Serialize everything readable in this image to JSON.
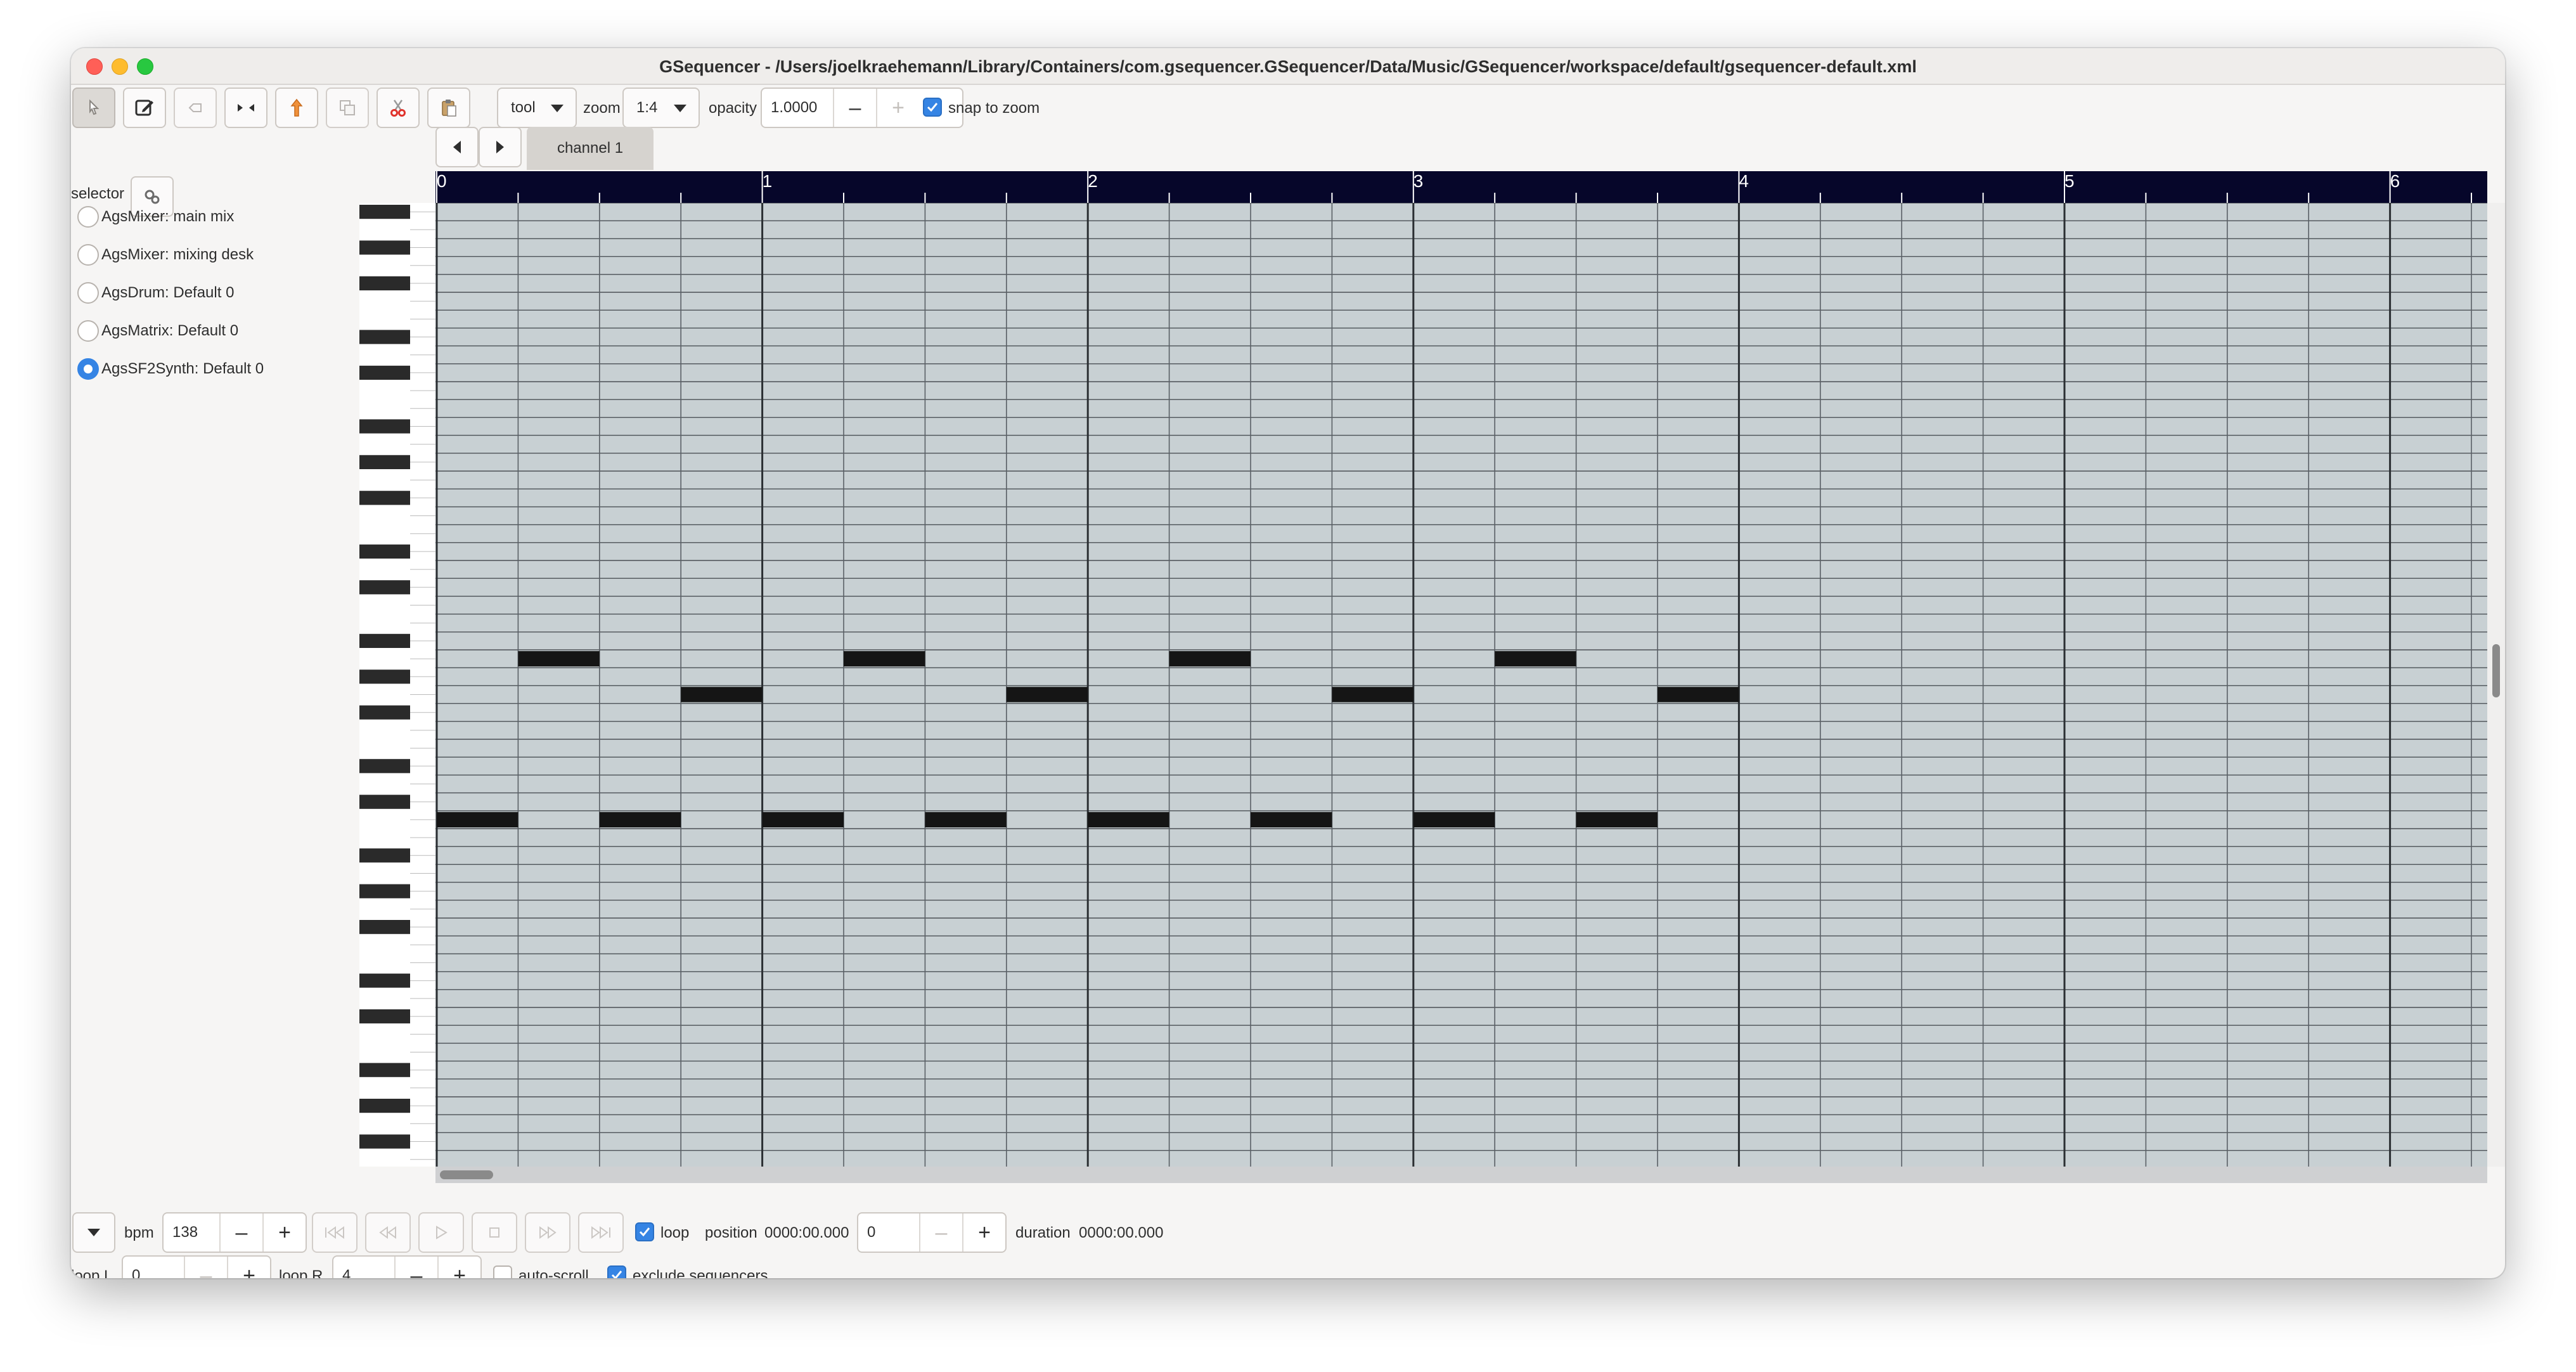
{
  "window": {
    "title": "GSequencer - /Users/joelkraehemann/Library/Containers/com.gsequencer.GSequencer/Data/Music/GSequencer/workspace/default/gsequencer-default.xml"
  },
  "toolbar": {
    "tool_label": "tool",
    "zoom_label": "zoom",
    "zoom_value": "1:4",
    "opacity_label": "opacity",
    "opacity_value": "1.0000",
    "snap_label": "snap to zoom",
    "snap_checked": true,
    "buttons": [
      "pointer",
      "edit",
      "clear",
      "select",
      "position",
      "copy",
      "cut",
      "paste"
    ]
  },
  "selector": {
    "label": "selector",
    "machines": [
      {
        "label": "AgsMixer: main mix",
        "selected": false
      },
      {
        "label": "AgsMixer: mixing desk",
        "selected": false
      },
      {
        "label": "AgsDrum: Default 0",
        "selected": false
      },
      {
        "label": "AgsMatrix: Default 0",
        "selected": false
      },
      {
        "label": "AgsSF2Synth: Default 0",
        "selected": true
      }
    ]
  },
  "editor": {
    "tab_label": "channel 1",
    "ruler_numbers": [
      "0",
      "1",
      "2",
      "3",
      "4",
      "5",
      "6"
    ],
    "notes": [
      {
        "key": 25,
        "start": 0.25,
        "length": 0.25
      },
      {
        "key": 25,
        "start": 1.25,
        "length": 0.25
      },
      {
        "key": 25,
        "start": 2.25,
        "length": 0.25
      },
      {
        "key": 25,
        "start": 3.25,
        "length": 0.25
      },
      {
        "key": 27,
        "start": 0.75,
        "length": 0.25
      },
      {
        "key": 27,
        "start": 1.75,
        "length": 0.25
      },
      {
        "key": 27,
        "start": 2.75,
        "length": 0.25
      },
      {
        "key": 27,
        "start": 3.75,
        "length": 0.25
      },
      {
        "key": 34,
        "start": 0.0,
        "length": 0.25
      },
      {
        "key": 34,
        "start": 0.5,
        "length": 0.25
      },
      {
        "key": 34,
        "start": 1.0,
        "length": 0.25
      },
      {
        "key": 34,
        "start": 1.5,
        "length": 0.25
      },
      {
        "key": 34,
        "start": 2.0,
        "length": 0.25
      },
      {
        "key": 34,
        "start": 2.5,
        "length": 0.25
      },
      {
        "key": 34,
        "start": 3.0,
        "length": 0.25
      },
      {
        "key": 34,
        "start": 3.5,
        "length": 0.25
      }
    ],
    "colors": {
      "grid_background": "#c8d0d3",
      "ruler_background": "#06062a",
      "note": "#151515"
    }
  },
  "transport": {
    "bpm_label": "bpm",
    "bpm_value": "138",
    "loop_label": "loop",
    "loop_checked": true,
    "position_label": "position",
    "position_time": "0000:00.000",
    "position_value": "0",
    "duration_label": "duration",
    "duration_time": "0000:00.000",
    "loop_l_label": "loop L",
    "loop_l_value": "0",
    "loop_r_label": "loop R",
    "loop_r_value": "4",
    "auto_scroll_label": "auto-scroll",
    "auto_scroll_checked": false,
    "exclude_label": "exclude sequencers",
    "exclude_checked": true
  }
}
